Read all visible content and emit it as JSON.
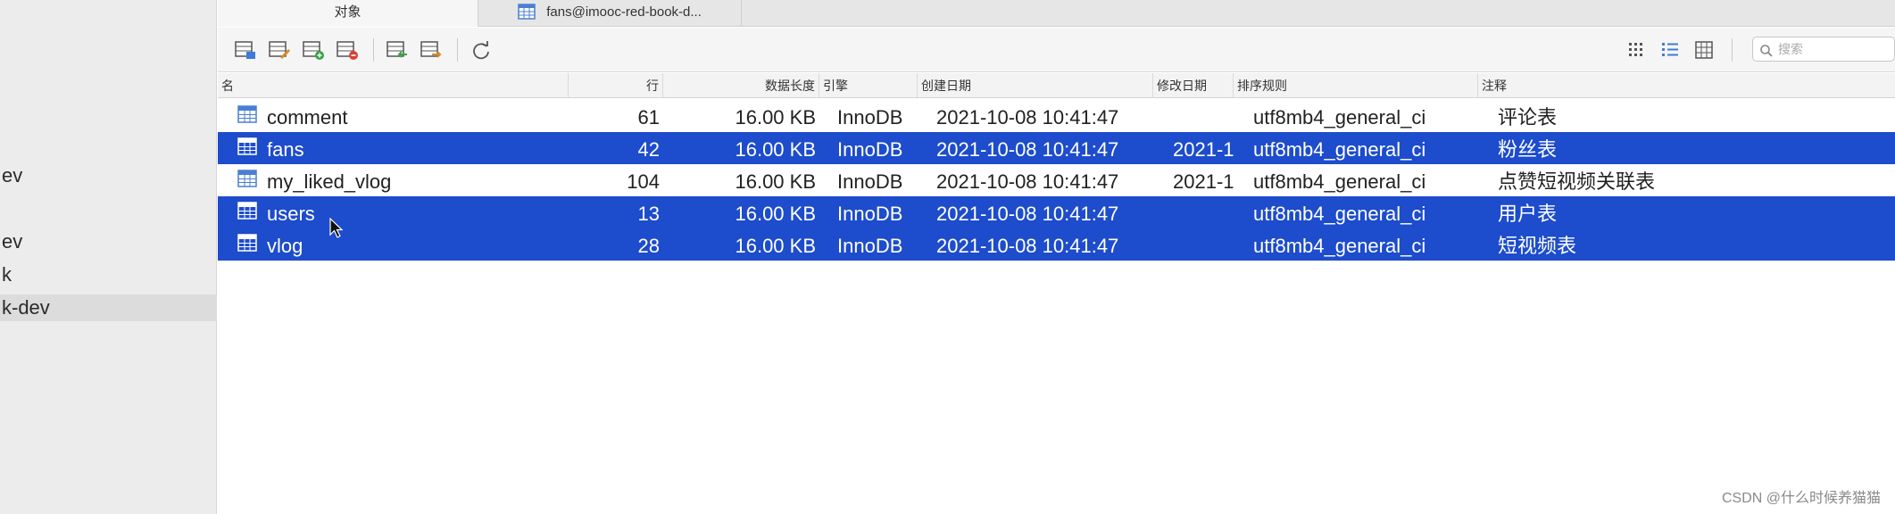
{
  "sidebar": {
    "items": [
      {
        "label": "ev"
      },
      {
        "label": "ev"
      },
      {
        "label": "k"
      },
      {
        "label": "k-dev"
      }
    ]
  },
  "tabs": [
    {
      "label": "对象"
    },
    {
      "label": "fans@imooc-red-book-d..."
    }
  ],
  "toolbar": {
    "search_placeholder": "搜索"
  },
  "table": {
    "columns": [
      "名",
      "行",
      "数据长度",
      "引擎",
      "创建日期",
      "修改日期",
      "排序规则",
      "注释"
    ],
    "rows": [
      {
        "name": "comment",
        "rows": "61",
        "data_length": "16.00 KB",
        "engine": "InnoDB",
        "created": "2021-10-08 10:41:47",
        "modified": "",
        "collation": "utf8mb4_general_ci",
        "comment": "评论表",
        "selected": false
      },
      {
        "name": "fans",
        "rows": "42",
        "data_length": "16.00 KB",
        "engine": "InnoDB",
        "created": "2021-10-08 10:41:47",
        "modified": "2021-1(",
        "collation": "utf8mb4_general_ci",
        "comment": "粉丝表",
        "selected": true
      },
      {
        "name": "my_liked_vlog",
        "rows": "104",
        "data_length": "16.00 KB",
        "engine": "InnoDB",
        "created": "2021-10-08 10:41:47",
        "modified": "2021-1(",
        "collation": "utf8mb4_general_ci",
        "comment": "点赞短视频关联表",
        "selected": false
      },
      {
        "name": "users",
        "rows": "13",
        "data_length": "16.00 KB",
        "engine": "InnoDB",
        "created": "2021-10-08 10:41:47",
        "modified": "",
        "collation": "utf8mb4_general_ci",
        "comment": "用户表",
        "selected": true
      },
      {
        "name": "vlog",
        "rows": "28",
        "data_length": "16.00 KB",
        "engine": "InnoDB",
        "created": "2021-10-08 10:41:47",
        "modified": "",
        "collation": "utf8mb4_general_ci",
        "comment": "短视频表",
        "selected": true
      }
    ]
  },
  "watermark": "CSDN @什么时候养猫猫",
  "colors": {
    "selection": "#1d4ccc",
    "table_icon": "#4a7fd4"
  }
}
